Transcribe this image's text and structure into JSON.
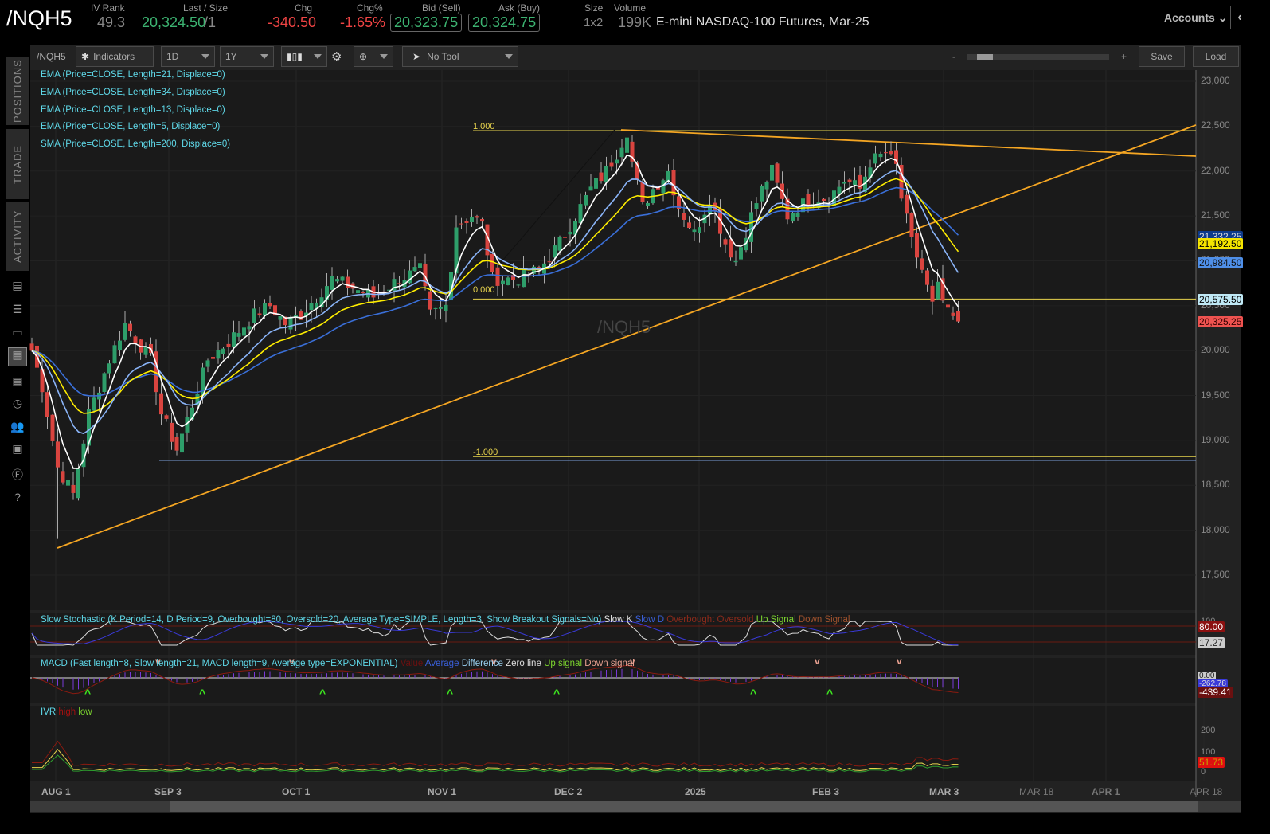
{
  "header": {
    "symbol": "/NQH5",
    "iv_rank_label": "IV Rank",
    "iv_rank": "49.3",
    "last_label": "Last / Size",
    "last": "20,324.50",
    "size": "/1",
    "chg_label": "Chg",
    "chg": "-340.50",
    "chgpct_label": "Chg%",
    "chgpct": "-1.65%",
    "bid_label": "Bid (Sell)",
    "bid": "20,323.75",
    "ask_label": "Ask (Buy)",
    "ask": "20,324.75",
    "sz_label": "Size",
    "sz": "1x2",
    "vol_label": "Volume",
    "vol": "199K",
    "description": "E-mini NASDAQ-100 Futures, Mar-25",
    "accounts": "Accounts"
  },
  "toolbar": {
    "symbol": "/NQH5",
    "indicators": "Indicators",
    "aggregation": "1D",
    "range": "1Y",
    "tool": "No Tool",
    "zoom_minus": "-",
    "zoom_plus": "+",
    "save": "Save",
    "load": "Load"
  },
  "sidebar": {
    "tabs": [
      "POSITIONS",
      "TRADE",
      "ACTIVITY"
    ]
  },
  "studies": [
    "EMA (Price=CLOSE, Length=21, Displace=0)",
    "EMA (Price=CLOSE, Length=34, Displace=0)",
    "EMA (Price=CLOSE, Length=13, Displace=0)",
    "EMA (Price=CLOSE, Length=5, Displace=0)",
    "SMA (Price=CLOSE, Length=200, Displace=0)"
  ],
  "watermark": "/NQH5",
  "fib": {
    "top": "1.000",
    "mid": "0.000",
    "bottom": "-1.000"
  },
  "colors": {
    "up": "#2e9e6a",
    "down": "#d9443f",
    "ema5": "#ffffff",
    "ema13": "#8ab4f8",
    "ema21": "#ffee00",
    "ema34": "#3a6fd8",
    "trend": "#f5a623",
    "fib": "#e8d44d"
  },
  "price_tags": [
    {
      "v": "21,332.25",
      "bg": "#0d3a8c",
      "fg": "#ddd"
    },
    {
      "v": "21,192.50",
      "bg": "#f5e400",
      "fg": "#000"
    },
    {
      "v": "20,984.50",
      "bg": "#4f8fe8",
      "fg": "#111"
    },
    {
      "v": "20,575.50",
      "bg": "#bfe8f5",
      "fg": "#000"
    },
    {
      "v": "20,325.25",
      "bg": "#ef5350",
      "fg": "#300"
    }
  ],
  "stoch": {
    "title": "Slow Stochastic (K Period=14, D Period=9, Overbought=80, Oversold=20, Average Type=SIMPLE, Length=3, Show Breakout Signals=No)",
    "legend": [
      "Slow K",
      "Slow D",
      "Overbought",
      "Oversold",
      "Up Signal",
      "Down Signal"
    ],
    "ob": "80.00",
    "k": "17.27",
    "axis_top": "100"
  },
  "macd": {
    "title": "MACD (Fast length=8, Slow length=21, MACD length=9, Average type=EXPONENTIAL)",
    "legend": [
      "Value",
      "Average",
      "Difference",
      "Zero line",
      "Up signal",
      "Down signal"
    ],
    "zero": "0.00",
    "avg": "-262.78",
    "value": "-439.41"
  },
  "ivr": {
    "title": "IVR",
    "legend": [
      "high",
      "low"
    ],
    "axis": [
      "200",
      "100",
      "0"
    ],
    "value": "51.73"
  },
  "chart_data": {
    "type": "candlestick",
    "title": "/NQH5 1D 1Y",
    "y_ticks": [
      "23,000",
      "22,500",
      "22,000",
      "21,500",
      "21,000",
      "20,500",
      "20,000",
      "19,500",
      "19,000",
      "18,500",
      "18,000",
      "17,500"
    ],
    "ylim": [
      17500,
      23000
    ],
    "x_ticks": [
      "AUG 1",
      "SEP 3",
      "OCT 1",
      "NOV 1",
      "DEC 2",
      "2025",
      "FEB 3",
      "MAR 3",
      "MAR 18",
      "APR 1",
      "APR 18"
    ],
    "close_path": [
      [
        0,
        20000
      ],
      [
        2,
        19600
      ],
      [
        5,
        18700
      ],
      [
        8,
        18400
      ],
      [
        11,
        19300
      ],
      [
        15,
        19900
      ],
      [
        18,
        20300
      ],
      [
        21,
        20050
      ],
      [
        23,
        19900
      ],
      [
        25,
        19300
      ],
      [
        28,
        18900
      ],
      [
        31,
        19400
      ],
      [
        34,
        19900
      ],
      [
        38,
        20100
      ],
      [
        43,
        20400
      ],
      [
        46,
        20500
      ],
      [
        49,
        20300
      ],
      [
        52,
        20400
      ],
      [
        55,
        20600
      ],
      [
        58,
        20800
      ],
      [
        62,
        20700
      ],
      [
        66,
        20600
      ],
      [
        71,
        20800
      ],
      [
        75,
        20900
      ],
      [
        77,
        20400
      ],
      [
        80,
        20500
      ],
      [
        82,
        21400
      ],
      [
        85,
        21500
      ],
      [
        87,
        21400
      ],
      [
        89,
        20800
      ],
      [
        94,
        20800
      ],
      [
        98,
        20900
      ],
      [
        102,
        21200
      ],
      [
        105,
        21500
      ],
      [
        108,
        21800
      ],
      [
        111,
        22000
      ],
      [
        113,
        22200
      ],
      [
        115,
        22450
      ],
      [
        116,
        22100
      ],
      [
        118,
        21600
      ],
      [
        120,
        21800
      ],
      [
        123,
        22000
      ],
      [
        125,
        21600
      ],
      [
        128,
        21300
      ],
      [
        131,
        21700
      ],
      [
        134,
        21200
      ],
      [
        136,
        21000
      ],
      [
        139,
        21500
      ],
      [
        141,
        21800
      ],
      [
        143,
        22000
      ],
      [
        146,
        21500
      ],
      [
        148,
        21600
      ],
      [
        151,
        21700
      ],
      [
        154,
        21700
      ],
      [
        157,
        21900
      ],
      [
        160,
        21800
      ],
      [
        162,
        22100
      ],
      [
        165,
        22200
      ],
      [
        167,
        22050
      ],
      [
        168,
        21700
      ],
      [
        170,
        21200
      ],
      [
        172,
        20900
      ],
      [
        174,
        20500
      ],
      [
        175,
        20700
      ],
      [
        177,
        20400
      ],
      [
        179,
        20325
      ]
    ],
    "fib_levels": [
      22450,
      20575,
      18800
    ],
    "support_line": 18780,
    "trendlines": [
      [
        [
          5,
          17820
        ],
        [
          [
            205,
            22500
          ]
        ]
      ]
    ]
  }
}
